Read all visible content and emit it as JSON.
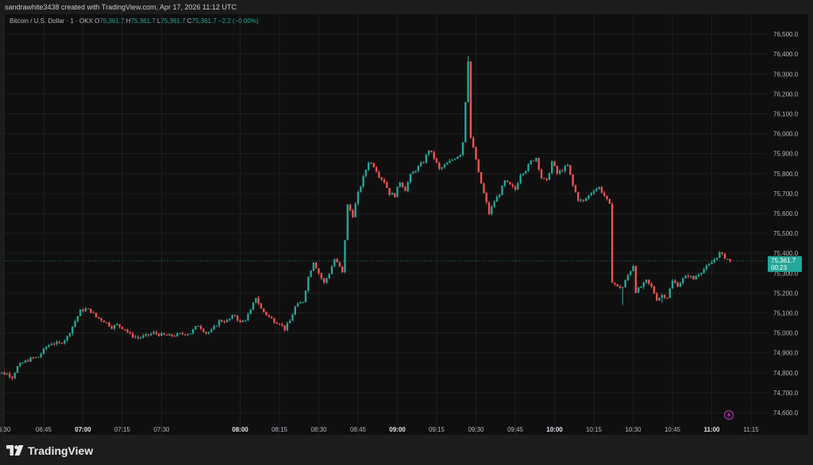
{
  "header": {
    "text": "sandrawhite3438 created with TradingView.com, Apr 17, 2026 11:12 UTC"
  },
  "legend": {
    "symbol": "Bitcoin / U.S. Dollar · 1 · OKX",
    "o_label": "O",
    "o_value": "75,361.7",
    "h_label": "H",
    "h_value": "75,361.7",
    "l_label": "L",
    "l_value": "75,361.7",
    "c_label": "C",
    "c_value": "75,361.7",
    "change": "−2.2 (−0.00%)"
  },
  "price_tag": {
    "price": "75,361.7",
    "countdown": "00:23"
  },
  "footer": {
    "logo_text": "TradingView"
  },
  "colors": {
    "up": "#26a69a",
    "down": "#ef5350",
    "background": "#0f0f0f",
    "grid": "#1f1f1f",
    "tag": "#26a69a"
  },
  "chart_data": {
    "type": "candlestick",
    "title": "Bitcoin / U.S. Dollar · 1 · OKX",
    "y_ticks": [
      "74,600.0",
      "74,700.0",
      "74,800.0",
      "74,900.0",
      "75,000.0",
      "75,100.0",
      "75,200.0",
      "75,300.0",
      "75,400.0",
      "75,500.0",
      "75,600.0",
      "75,700.0",
      "75,800.0",
      "75,900.0",
      "76,000.0",
      "76,100.0",
      "76,200.0",
      "76,300.0",
      "76,400.0",
      "76,500.0"
    ],
    "ylim": [
      74560,
      76560
    ],
    "x_ticks": [
      {
        "label": "6:30",
        "minute": -15,
        "bold": false
      },
      {
        "label": "06:45",
        "minute": 0,
        "bold": false
      },
      {
        "label": "07:00",
        "minute": 15,
        "bold": true
      },
      {
        "label": "07:15",
        "minute": 30,
        "bold": false
      },
      {
        "label": "07:30",
        "minute": 45,
        "bold": false
      },
      {
        "label": "08:00",
        "minute": 75,
        "bold": true
      },
      {
        "label": "08:15",
        "minute": 90,
        "bold": false
      },
      {
        "label": "08:30",
        "minute": 105,
        "bold": false
      },
      {
        "label": "08:45",
        "minute": 120,
        "bold": false
      },
      {
        "label": "09:00",
        "minute": 135,
        "bold": true
      },
      {
        "label": "09:15",
        "minute": 150,
        "bold": false
      },
      {
        "label": "09:30",
        "minute": 165,
        "bold": false
      },
      {
        "label": "09:45",
        "minute": 180,
        "bold": false
      },
      {
        "label": "10:00",
        "minute": 195,
        "bold": true
      },
      {
        "label": "10:15",
        "minute": 210,
        "bold": false
      },
      {
        "label": "10:30",
        "minute": 225,
        "bold": false
      },
      {
        "label": "10:45",
        "minute": 240,
        "bold": false
      },
      {
        "label": "11:00",
        "minute": 255,
        "bold": true
      },
      {
        "label": "11:15",
        "minute": 270,
        "bold": false
      }
    ],
    "last_price": 75361.7,
    "anchors": [
      [
        -20,
        74800
      ],
      [
        -17,
        74800
      ],
      [
        -14,
        74795
      ],
      [
        -12,
        74780
      ],
      [
        -10,
        74830
      ],
      [
        -8,
        74850
      ],
      [
        -5,
        74870
      ],
      [
        -2,
        74880
      ],
      [
        1,
        74930
      ],
      [
        3,
        74950
      ],
      [
        6,
        74945
      ],
      [
        9,
        74980
      ],
      [
        12,
        75060
      ],
      [
        14,
        75110
      ],
      [
        16,
        75120
      ],
      [
        18,
        75110
      ],
      [
        20,
        75080
      ],
      [
        23,
        75060
      ],
      [
        26,
        75030
      ],
      [
        28,
        75040
      ],
      [
        31,
        75020
      ],
      [
        33,
        74990
      ],
      [
        36,
        74975
      ],
      [
        39,
        74985
      ],
      [
        42,
        75000
      ],
      [
        45,
        74990
      ],
      [
        48,
        74985
      ],
      [
        51,
        74990
      ],
      [
        53,
        74995
      ],
      [
        56,
        75000
      ],
      [
        59,
        75040
      ],
      [
        62,
        75000
      ],
      [
        64,
        75010
      ],
      [
        67,
        75060
      ],
      [
        70,
        75060
      ],
      [
        73,
        75090
      ],
      [
        75,
        75050
      ],
      [
        77,
        75070
      ],
      [
        79,
        75110
      ],
      [
        81,
        75180
      ],
      [
        83,
        75120
      ],
      [
        86,
        75080
      ],
      [
        88,
        75060
      ],
      [
        90,
        75050
      ],
      [
        92,
        75020
      ],
      [
        94,
        75060
      ],
      [
        96,
        75130
      ],
      [
        99,
        75160
      ],
      [
        101,
        75280
      ],
      [
        103,
        75360
      ],
      [
        105,
        75300
      ],
      [
        107,
        75250
      ],
      [
        109,
        75300
      ],
      [
        111,
        75370
      ],
      [
        113,
        75330
      ],
      [
        114,
        75300
      ],
      [
        116,
        75640
      ],
      [
        118,
        75590
      ],
      [
        120,
        75700
      ],
      [
        122,
        75780
      ],
      [
        124,
        75860
      ],
      [
        126,
        75840
      ],
      [
        128,
        75790
      ],
      [
        130,
        75760
      ],
      [
        132,
        75700
      ],
      [
        134,
        75690
      ],
      [
        136,
        75760
      ],
      [
        138,
        75720
      ],
      [
        140,
        75790
      ],
      [
        142,
        75820
      ],
      [
        145,
        75860
      ],
      [
        147,
        75920
      ],
      [
        149,
        75880
      ],
      [
        151,
        75820
      ],
      [
        153,
        75840
      ],
      [
        155,
        75860
      ],
      [
        157,
        75880
      ],
      [
        159,
        75900
      ],
      [
        160,
        75960
      ],
      [
        162,
        76370
      ],
      [
        163,
        75980
      ],
      [
        165,
        75870
      ],
      [
        166,
        75800
      ],
      [
        168,
        75700
      ],
      [
        170,
        75600
      ],
      [
        172,
        75660
      ],
      [
        174,
        75700
      ],
      [
        176,
        75760
      ],
      [
        178,
        75740
      ],
      [
        180,
        75720
      ],
      [
        182,
        75800
      ],
      [
        184,
        75820
      ],
      [
        186,
        75860
      ],
      [
        188,
        75880
      ],
      [
        190,
        75780
      ],
      [
        192,
        75760
      ],
      [
        194,
        75860
      ],
      [
        196,
        75800
      ],
      [
        198,
        75820
      ],
      [
        200,
        75840
      ],
      [
        202,
        75740
      ],
      [
        204,
        75670
      ],
      [
        206,
        75660
      ],
      [
        208,
        75690
      ],
      [
        210,
        75720
      ],
      [
        212,
        75730
      ],
      [
        214,
        75690
      ],
      [
        216,
        75640
      ],
      [
        217,
        75260
      ],
      [
        219,
        75230
      ],
      [
        221,
        75230
      ],
      [
        223,
        75290
      ],
      [
        225,
        75340
      ],
      [
        226,
        75210
      ],
      [
        228,
        75230
      ],
      [
        230,
        75260
      ],
      [
        232,
        75230
      ],
      [
        234,
        75170
      ],
      [
        236,
        75190
      ],
      [
        238,
        75180
      ],
      [
        240,
        75260
      ],
      [
        242,
        75240
      ],
      [
        244,
        75270
      ],
      [
        246,
        75290
      ],
      [
        248,
        75270
      ],
      [
        250,
        75300
      ],
      [
        252,
        75320
      ],
      [
        254,
        75340
      ],
      [
        256,
        75370
      ],
      [
        258,
        75400
      ],
      [
        260,
        75380
      ],
      [
        262,
        75362
      ]
    ]
  }
}
